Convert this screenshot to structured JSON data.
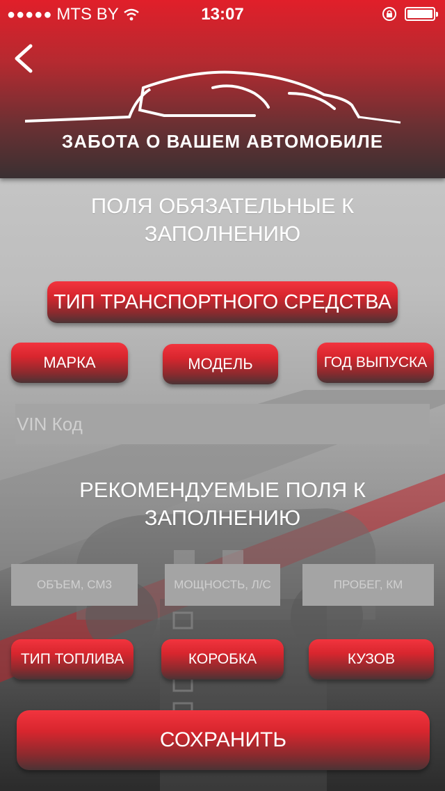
{
  "status_bar": {
    "signal_dots": "●●●●●",
    "carrier": "MTS BY",
    "time": "13:07"
  },
  "header": {
    "logo_text": "ЗАБОТА О ВАШЕМ АВТОМОБИЛЕ"
  },
  "required_section": {
    "title": "ПОЛЯ ОБЯЗАТЕЛЬНЫЕ К ЗАПОЛНЕНИЮ",
    "vehicle_type_label": "ТИП ТРАНСПОРТНОГО СРЕДСТВА",
    "make_label": "МАРКА",
    "model_label": "МОДЕЛЬ",
    "year_label": "ГОД ВЫПУСКА",
    "vin_placeholder": "VIN Код",
    "vin_value": ""
  },
  "recommended_section": {
    "title": "РЕКОМЕНДУЕМЫЕ ПОЛЯ К ЗАПОЛНЕНИЮ",
    "volume_placeholder": "ОБЪЕМ, СМ3",
    "power_placeholder": "МОЩНОСТЬ, Л/С",
    "mileage_placeholder": "ПРОБЕГ, КМ",
    "fuel_label": "ТИП ТОПЛИВА",
    "gearbox_label": "КОРОБКА",
    "body_label": "КУЗОВ"
  },
  "save_label": "СОХРАНИТЬ",
  "icons": [
    "back-chevron-icon",
    "wifi-icon",
    "rotation-lock-icon",
    "battery-icon",
    "car-logo-icon"
  ],
  "colors": {
    "accent_red": "#e11f2a",
    "input_gray": "#a4a4a4"
  }
}
